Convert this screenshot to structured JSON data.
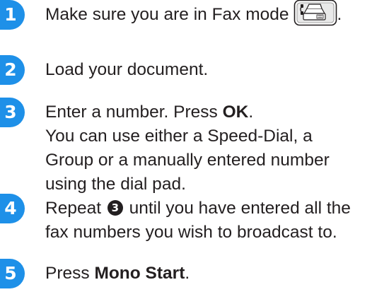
{
  "steps": [
    {
      "number": "1",
      "text": "Make sure you are in Fax mode",
      "icon": "fax-icon"
    },
    {
      "number": "2",
      "text": "Load your document."
    },
    {
      "number": "3",
      "line1_a": "Enter a number. Press ",
      "line1_b": "OK",
      "line1_c": ".",
      "line2": "You can use either a Speed-Dial, a",
      "line3": "Group or a manually entered number",
      "line4": "using the dial pad."
    },
    {
      "number": "4",
      "line1_a": "Repeat ",
      "ref": "3",
      "line1_b": " until you have entered all the",
      "line2": "fax numbers you wish to broadcast to."
    },
    {
      "number": "5",
      "line1_a": "Press ",
      "line1_b": "Mono Start",
      "line1_c": "."
    }
  ],
  "colors": {
    "bubble": "#1e90e8",
    "text": "#231f20"
  }
}
